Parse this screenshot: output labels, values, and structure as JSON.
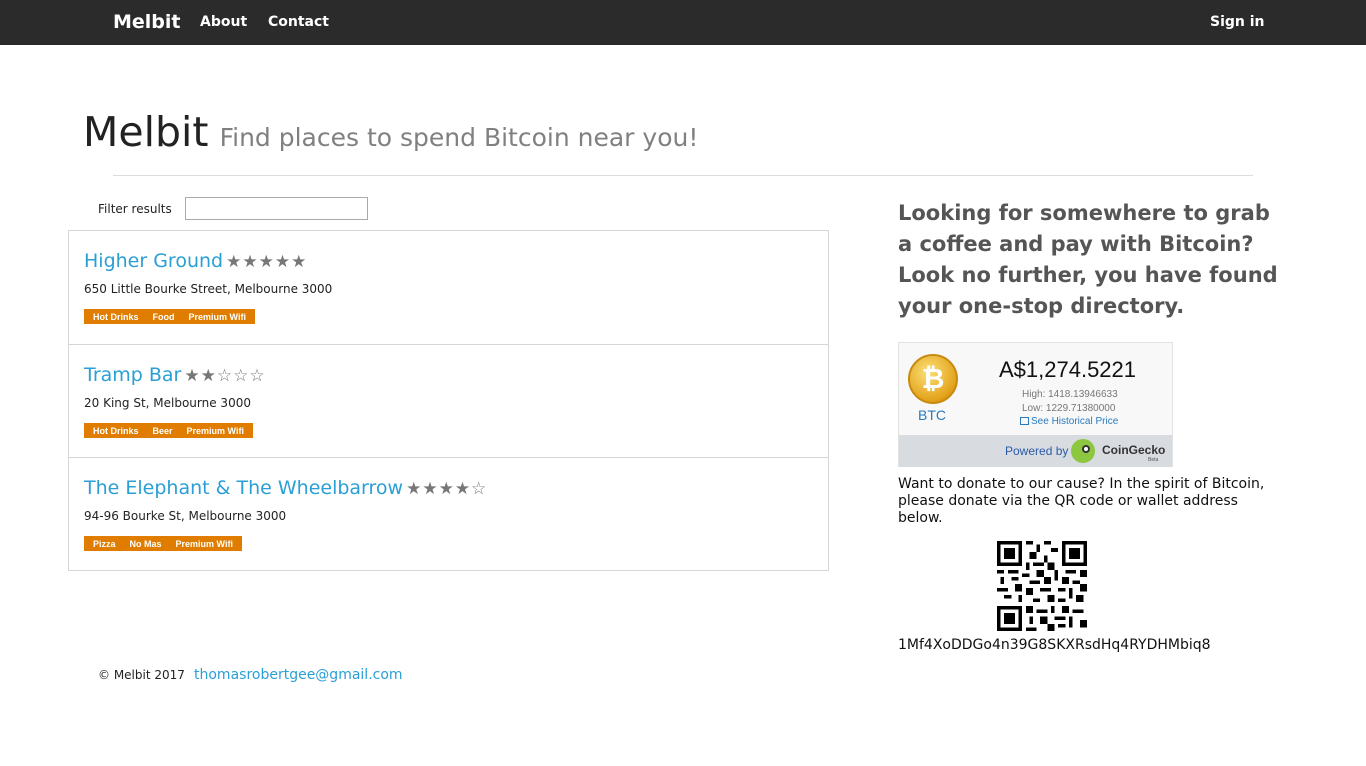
{
  "navbar": {
    "brand": "Melbit",
    "links": [
      "About",
      "Contact"
    ],
    "sign_in": "Sign in"
  },
  "header": {
    "title": "Melbit",
    "subtitle": "Find places to spend Bitcoin near you!"
  },
  "filter": {
    "label": "Filter results",
    "value": ""
  },
  "venues": [
    {
      "name": "Higher Ground",
      "rating": 5,
      "rating_display": "★★★★★",
      "address": "650 Little Bourke Street, Melbourne 3000",
      "tags": [
        "Hot Drinks",
        "Food",
        "Premium Wifi"
      ]
    },
    {
      "name": "Tramp Bar",
      "rating": 2,
      "rating_display": "★★☆☆☆",
      "address": "20 King St, Melbourne 3000",
      "tags": [
        "Hot Drinks",
        "Beer",
        "Premium Wifi"
      ]
    },
    {
      "name": "The Elephant & The Wheelbarrow",
      "rating": 4,
      "rating_display": "★★★★☆",
      "address": "94-96 Bourke St, Melbourne 3000",
      "tags": [
        "Pizza",
        "No Mas",
        "Premium Wifi"
      ]
    }
  ],
  "sidebar": {
    "tagline": "Looking for somewhere to grab a coffee and pay with Bitcoin? Look no further, you have found your one-stop directory.",
    "donate_text": "Want to donate to our cause? In the spirit of Bitcoin, please donate via the QR code or wallet address below.",
    "wallet_address": "1Mf4XoDDGo4n39G8SKXRsdHq4RYDHMbiq8"
  },
  "price_widget": {
    "currency_label": "BTC",
    "price": "A$1,274.5221",
    "high": "High: 1418.13946633",
    "low": "Low: 1229.71380000",
    "historical_link": "See Historical Price",
    "powered_by": "Powered by",
    "brand": "CoinGecko",
    "beta": "Beta"
  },
  "footer": {
    "copyright": "© Melbit 2017",
    "email": "thomasrobertgee@gmail.com"
  },
  "colors": {
    "navbar_bg": "#2b2b2b",
    "link": "#2a9fd6",
    "tag_bg": "#e07d00",
    "subtitle": "#808080"
  }
}
